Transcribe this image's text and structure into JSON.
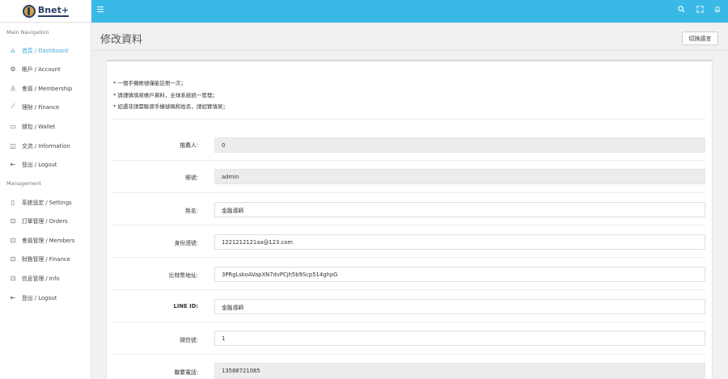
{
  "app": {
    "logo_text": "Bnet+"
  },
  "page": {
    "title": "修改資料",
    "lang_button": "切換語言"
  },
  "sidebar": {
    "main_header": "Main Navigation",
    "main_items": [
      {
        "label": "首頁 / Dashboard",
        "icon": "home-icon",
        "active": true
      },
      {
        "label": "帳戶 / Account",
        "icon": "settings-icon"
      },
      {
        "label": "會員 / Membership",
        "icon": "user-icon"
      },
      {
        "label": "理財 / Finance",
        "icon": "chart-line-icon"
      },
      {
        "label": "錢包 / Wallet",
        "icon": "wallet-icon"
      },
      {
        "label": "交流 / Information",
        "icon": "book-icon"
      },
      {
        "label": "登出 / Logout",
        "icon": "logout-icon"
      }
    ],
    "mgmt_header": "Management",
    "mgmt_items": [
      {
        "label": "系統設定 / Settings",
        "icon": "document-icon"
      },
      {
        "label": "訂單管理 / Orders",
        "icon": "puzzle-icon"
      },
      {
        "label": "會員管理 / Members",
        "icon": "puzzle-icon"
      },
      {
        "label": "財務管理 / Finance",
        "icon": "puzzle-icon"
      },
      {
        "label": "信息管理 / Info",
        "icon": "puzzle-icon"
      },
      {
        "label": "登出 / Logout",
        "icon": "logout-icon"
      }
    ]
  },
  "notes": [
    "* 一個手機帳號僅能註冊一次；",
    "* 請謹慎填寫帳戶資料，全球系統統一管理；",
    "* 如遇非請需聯源手機號碼和姓名，請如實填寫；"
  ],
  "form": {
    "rows": [
      {
        "label": "推薦人:",
        "value": "0",
        "readonly": true,
        "bold": false
      },
      {
        "label": "賬號:",
        "value": "admin",
        "readonly": true,
        "bold": false
      },
      {
        "label": "姓名:",
        "value": "金融導師",
        "readonly": false,
        "bold": false
      },
      {
        "label": "身份證號:",
        "value": "1221212121aa@123.com",
        "readonly": false,
        "bold": false
      },
      {
        "label": "比特幣地址:",
        "value": "3PRgLskoAVapXN7dvPCjh5b9Scp514ghpG",
        "readonly": false,
        "bold": false
      },
      {
        "label": "LINE ID:",
        "value": "金融導師",
        "readonly": false,
        "bold": true
      },
      {
        "label": "微信號:",
        "value": "1",
        "readonly": false,
        "bold": false
      },
      {
        "label": "聯繫電話:",
        "value": "13588721085",
        "readonly": true,
        "bold": false
      }
    ]
  },
  "colors": {
    "topbar": "#3bb9e6",
    "active_nav": "#3aa8d8"
  }
}
